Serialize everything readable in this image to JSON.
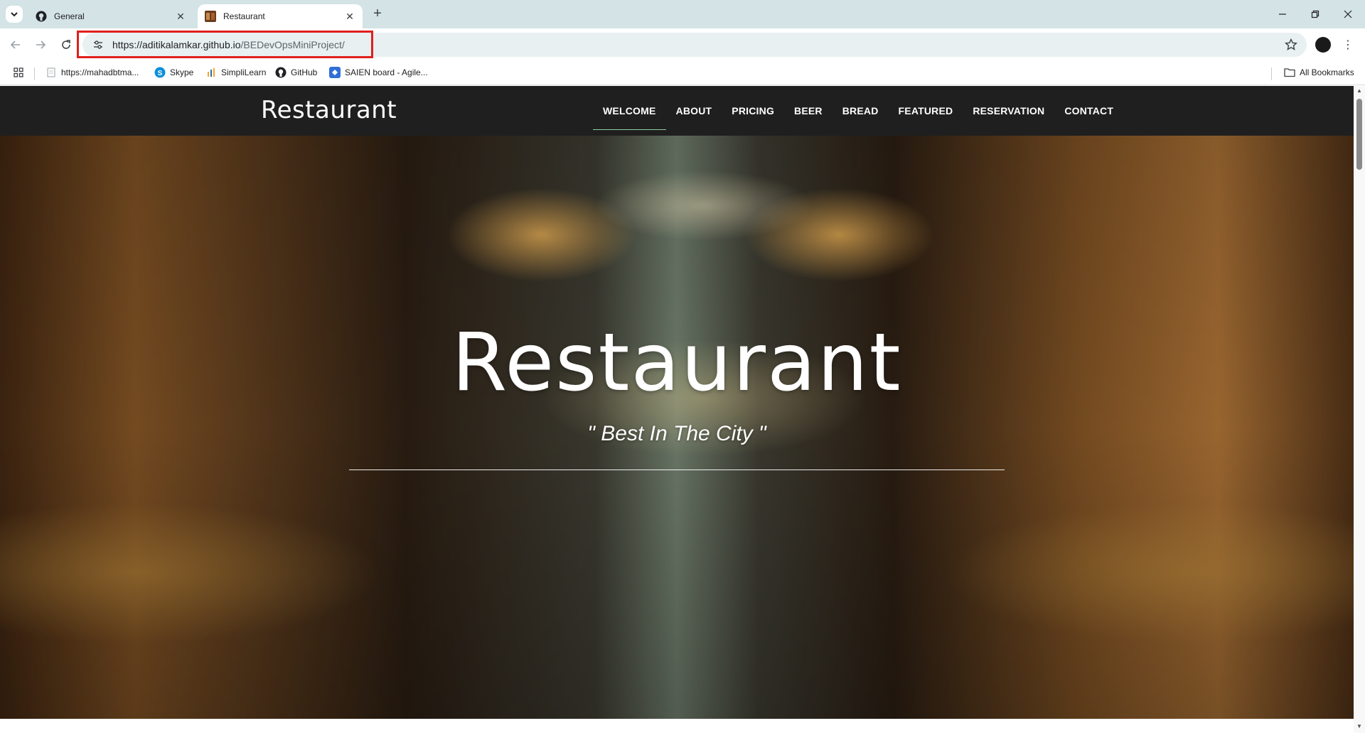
{
  "browser": {
    "tabs": [
      {
        "title": "General",
        "icon": "github-icon",
        "active": false
      },
      {
        "title": "Restaurant",
        "icon": "restaurant-favicon",
        "active": true
      }
    ],
    "url": {
      "host": "https://aditikalamkar.github.io",
      "path": "/BEDevOpsMiniProject/"
    },
    "bookmarks": [
      {
        "label": "https://mahadbtma...",
        "icon": "page-icon"
      },
      {
        "label": "Skype",
        "icon": "skype-icon"
      },
      {
        "label": "SimpliLearn",
        "icon": "simplilearn-icon"
      },
      {
        "label": "GitHub",
        "icon": "github-icon"
      },
      {
        "label": "SAIEN board - Agile...",
        "icon": "jira-icon"
      }
    ],
    "all_bookmarks": "All Bookmarks"
  },
  "site": {
    "brand": "Restaurant",
    "menu": [
      "WELCOME",
      "ABOUT",
      "PRICING",
      "BEER",
      "BREAD",
      "FEATURED",
      "RESERVATION",
      "CONTACT"
    ],
    "active_menu": "WELCOME",
    "hero_title": "Restaurant",
    "hero_subtitle": "\" Best In The City \""
  },
  "colors": {
    "nav_bg": "#1f1f1f",
    "highlight": "#e0201d",
    "tab_strip": "#d3e3e6"
  }
}
